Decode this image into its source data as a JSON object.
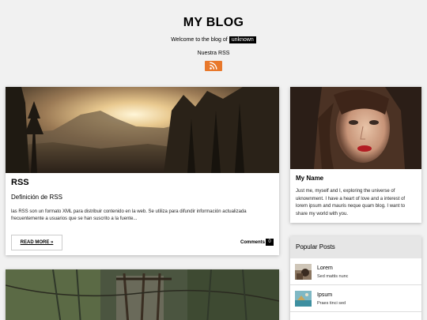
{
  "header": {
    "title": "MY BLOG",
    "welcome_prefix": "Welcome to the blog of",
    "user_tag": "unknown",
    "rss_label": "Nuestra RSS"
  },
  "post": {
    "title": "RSS",
    "subtitle": "Definición de RSS",
    "excerpt": "las RSS son un formato XML para distribuir contenido en la web. Se utiliza para difundir información actualizada frecuentemente a usuarios que se han suscrito a la fuente...",
    "read_more": "READ MORE »",
    "comments_label": "Comments",
    "comments_count": "0"
  },
  "profile": {
    "name": "My Name",
    "bio": "Just me, myself and I, exploring the universe of uknownment. I have a heart of love and a interest of lorem ipsum and mauris neque quam blog. I want to share my world with you."
  },
  "popular": {
    "heading": "Popular Posts",
    "items": [
      {
        "title": "Lorem",
        "subtitle": "Sed mattis nunc"
      },
      {
        "title": "Ipsum",
        "subtitle": "Praes tinci sed"
      }
    ]
  },
  "colors": {
    "rss_orange": "#e8782b",
    "background": "#f1f1f1"
  },
  "icons": {
    "rss": "rss-icon"
  }
}
